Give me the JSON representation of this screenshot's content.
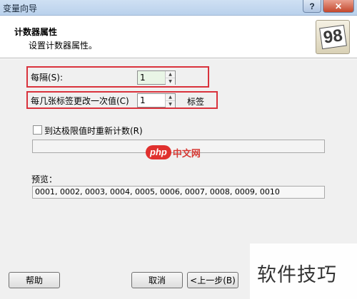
{
  "window": {
    "title": "变量向导",
    "help_glyph": "?",
    "close_glyph": "✕"
  },
  "header": {
    "title": "计数器属性",
    "subtitle": "设置计数器属性。",
    "icon": "counter-98-icon",
    "icon_text": "98"
  },
  "form": {
    "interval_label": "每隔(S):",
    "interval_value": "1",
    "change_label": "每几张标签更改一次值(C)",
    "change_value": "1",
    "change_unit": "标签",
    "reset_checkbox_label": "到达极限值时重新计数(R)",
    "reset_checked": false,
    "preview_label": "预览：",
    "preview_value": "0001, 0002, 0003, 0004, 0005, 0006, 0007, 0008, 0009, 0010"
  },
  "buttons": {
    "help": "帮助",
    "cancel": "取消",
    "back": "<上一步(B)"
  },
  "watermarks": {
    "php_badge": "php",
    "php_text": "中文网",
    "skill": "软件技巧"
  },
  "colors": {
    "highlight": "#d9323c"
  }
}
